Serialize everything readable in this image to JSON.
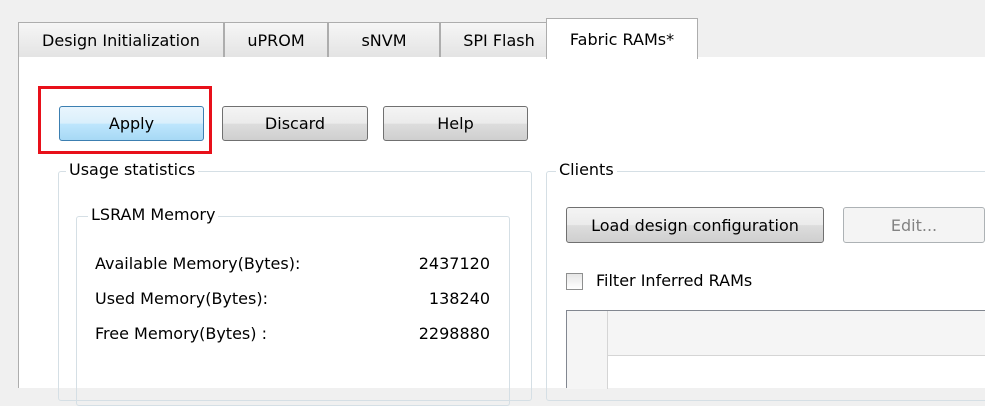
{
  "tabs": [
    {
      "label": "Design Initialization",
      "active": false
    },
    {
      "label": "uPROM",
      "active": false
    },
    {
      "label": "sNVM",
      "active": false
    },
    {
      "label": "SPI Flash",
      "active": false
    },
    {
      "label": "Fabric RAMs*",
      "active": true
    }
  ],
  "toolbar": {
    "apply_label": "Apply",
    "discard_label": "Discard",
    "help_label": "Help"
  },
  "usage": {
    "title": "Usage statistics",
    "lsram": {
      "title": "LSRAM Memory",
      "rows": [
        {
          "label": "Available Memory(Bytes):",
          "value": "2437120"
        },
        {
          "label": "Used Memory(Bytes):",
          "value": "138240"
        },
        {
          "label": "Free Memory(Bytes) :",
          "value": "2298880"
        }
      ]
    }
  },
  "clients": {
    "title": "Clients",
    "load_label": "Load design configuration",
    "edit_label": "Edit...",
    "filter_label": "Filter Inferred RAMs",
    "filter_checked": false
  },
  "colors": {
    "highlight": "#e8101a",
    "primary_border": "#3c7fb1"
  }
}
